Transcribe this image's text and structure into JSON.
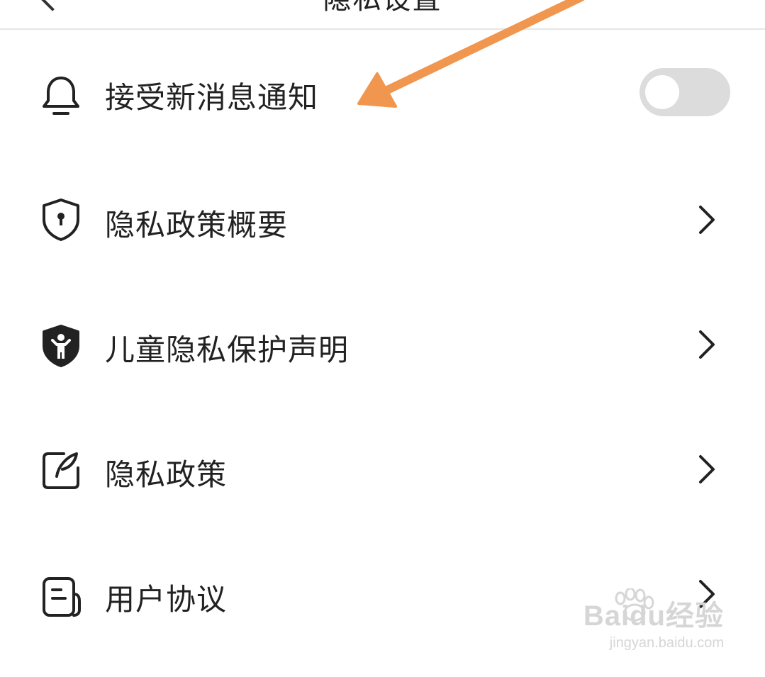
{
  "header": {
    "title": "隐私设置"
  },
  "settings": {
    "notification": {
      "label": "接受新消息通知",
      "icon": "bell-icon",
      "toggle_on": false
    },
    "items": [
      {
        "label": "隐私政策概要",
        "icon": "shield-lock-icon"
      },
      {
        "label": "儿童隐私保护声明",
        "icon": "shield-child-icon"
      },
      {
        "label": "隐私政策",
        "icon": "edit-note-icon"
      },
      {
        "label": "用户协议",
        "icon": "document-icon"
      }
    ]
  },
  "annotation": {
    "arrow_color": "#f0964f"
  },
  "watermark": {
    "logo": "Baidu经验",
    "url": "jingyan.baidu.com"
  },
  "colors": {
    "text": "#222222",
    "toggle_off": "#dcdcdc",
    "divider": "#e6e6e6"
  }
}
